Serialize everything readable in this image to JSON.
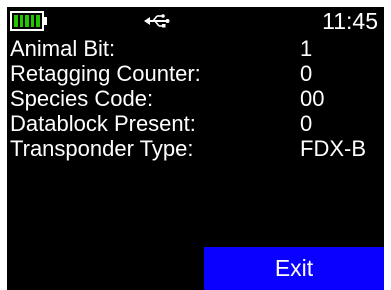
{
  "status_bar": {
    "battery_level": 1.0,
    "battery_color": "#22c600",
    "connection_icon": "usb-icon",
    "time": "11:45"
  },
  "fields": [
    {
      "label": "Animal Bit:",
      "value": "1"
    },
    {
      "label": "Retagging Counter:",
      "value": "0"
    },
    {
      "label": "Species Code:",
      "value": "00"
    },
    {
      "label": "Datablock Present:",
      "value": "0"
    },
    {
      "label": "Transponder Type:",
      "value": "FDX-B"
    }
  ],
  "softkey": {
    "exit_label": "Exit",
    "color": "#0a00ff"
  }
}
